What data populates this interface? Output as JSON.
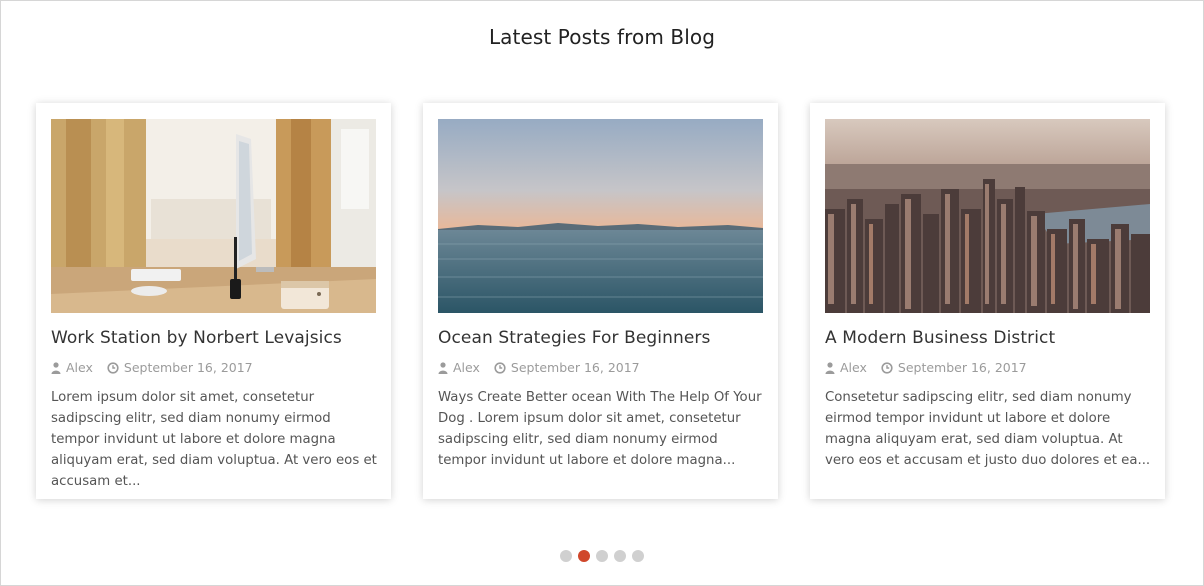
{
  "section": {
    "title": "Latest Posts from Blog"
  },
  "posts": [
    {
      "title": "Work Station by Norbert Levajsics",
      "author": "Alex",
      "date": "September 16, 2017",
      "excerpt": "Lorem ipsum dolor sit amet, consetetur sadipscing elitr, sed diam nonumy eirmod tempor invidunt ut labore et dolore magna aliquyam erat, sed diam voluptua. At vero eos et accusam et..."
    },
    {
      "title": "Ocean Strategies For Beginners",
      "author": "Alex",
      "date": "September 16, 2017",
      "excerpt": "Ways Create Better ocean With The Help Of Your Dog . Lorem ipsum dolor sit amet, consetetur sadipscing elitr, sed diam nonumy eirmod tempor invidunt ut labore et dolore magna..."
    },
    {
      "title": "A Modern Business District",
      "author": "Alex",
      "date": "September 16, 2017",
      "excerpt": "Consetetur sadipscing elitr, sed diam nonumy eirmod tempor invidunt ut labore et dolore magna aliquyam erat, sed diam voluptua. At vero eos et accusam et justo duo dolores et ea..."
    }
  ],
  "carousel": {
    "dots": 5,
    "active_index": 1
  },
  "colors": {
    "accent": "#d0472b",
    "meta": "#9b9b9b",
    "title": "#333333",
    "dot_inactive": "#d0d0d0"
  },
  "icons": {
    "author": "user-icon",
    "date": "clock-icon"
  }
}
